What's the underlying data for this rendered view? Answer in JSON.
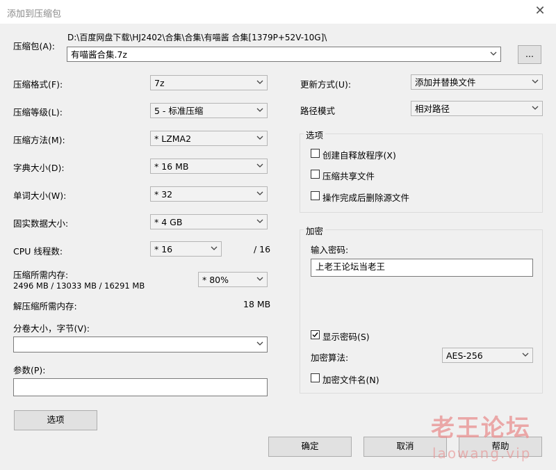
{
  "window": {
    "title": "添加到压缩包",
    "close_glyph": "✕"
  },
  "archive": {
    "label": "压缩包(A):",
    "path": "D:\\百度网盘下载\\HJ2402\\合集\\合集\\有喵酱 合集[1379P+52V-10G]\\",
    "name": "有喵酱合集.7z",
    "browse_label": "..."
  },
  "left": {
    "format": {
      "label": "压缩格式(F):",
      "value": "7z"
    },
    "level": {
      "label": "压缩等级(L):",
      "value": "5 - 标准压缩"
    },
    "method": {
      "label": "压缩方法(M):",
      "value": "* LZMA2"
    },
    "dict": {
      "label": "字典大小(D):",
      "value": "* 16 MB"
    },
    "word": {
      "label": "单词大小(W):",
      "value": "* 32"
    },
    "solid": {
      "label": "固实数据大小:",
      "value": "* 4 GB"
    },
    "threads": {
      "label": "CPU 线程数:",
      "value": "* 16",
      "max": "/ 16"
    },
    "memory": {
      "label": "压缩所需内存:",
      "detail": "2496 MB / 13033 MB / 16291 MB",
      "value": "* 80%"
    },
    "decomp": {
      "label": "解压缩所需内存:",
      "value": "18 MB"
    },
    "volume": {
      "label": "分卷大小，字节(V):",
      "value": ""
    },
    "params": {
      "label": "参数(P):",
      "value": ""
    },
    "options_button": "选项"
  },
  "right": {
    "update": {
      "label": "更新方式(U):",
      "value": "添加并替换文件"
    },
    "pathmode": {
      "label": "路径模式",
      "value": "相对路径"
    },
    "options_group": {
      "title": "选项",
      "sfx": "创建自释放程序(X)",
      "shared": "压缩共享文件",
      "delete": "操作完成后删除源文件"
    },
    "encryption": {
      "title": "加密",
      "pw_label": "输入密码:",
      "password": "上老王论坛当老王",
      "show_pw": "显示密码(S)",
      "algo_label": "加密算法:",
      "algo": "AES-256",
      "encrypt_names": "加密文件名(N)"
    }
  },
  "buttons": {
    "ok": "确定",
    "cancel": "取消",
    "help": "帮助"
  },
  "watermark": {
    "text": "老王论坛",
    "url": "laowang.vip"
  }
}
